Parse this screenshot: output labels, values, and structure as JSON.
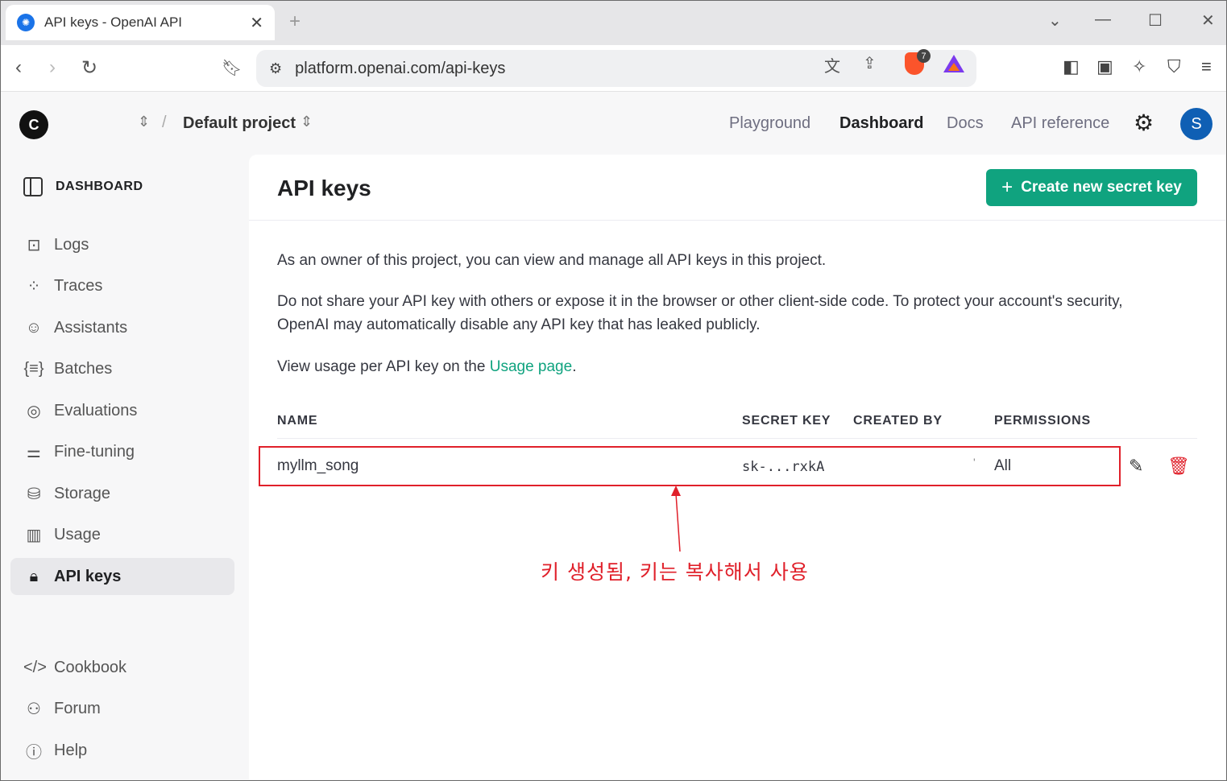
{
  "browser": {
    "tab_title": "API keys - OpenAI API",
    "url": "platform.openai.com/api-keys",
    "extension_badge": "7"
  },
  "header": {
    "org_initial": "C",
    "project_name": "Default project",
    "links": [
      "Playground",
      "Dashboard",
      "Docs",
      "API reference"
    ],
    "active_link": "Dashboard",
    "user_initial": "S"
  },
  "sidebar": {
    "heading": "DASHBOARD",
    "items": [
      {
        "label": "Logs",
        "icon": "terminal-icon"
      },
      {
        "label": "Traces",
        "icon": "traces-icon"
      },
      {
        "label": "Assistants",
        "icon": "assistant-icon"
      },
      {
        "label": "Batches",
        "icon": "batches-icon"
      },
      {
        "label": "Evaluations",
        "icon": "evaluations-icon"
      },
      {
        "label": "Fine-tuning",
        "icon": "sliders-icon"
      },
      {
        "label": "Storage",
        "icon": "database-icon"
      },
      {
        "label": "Usage",
        "icon": "bar-chart-icon"
      },
      {
        "label": "API keys",
        "icon": "lock-icon"
      }
    ],
    "active": "API keys",
    "footer_items": [
      {
        "label": "Cookbook",
        "icon": "code-icon"
      },
      {
        "label": "Forum",
        "icon": "users-icon"
      },
      {
        "label": "Help",
        "icon": "help-icon"
      }
    ]
  },
  "main": {
    "title": "API keys",
    "create_button": "Create new secret key",
    "paragraph1": "As an owner of this project, you can view and manage all API keys in this project.",
    "paragraph2": "Do not share your API key with others or expose it in the browser or other client-side code. To protect your account's security, OpenAI may automatically disable any API key that has leaked publicly.",
    "paragraph3_prefix": "View usage per API key on the ",
    "paragraph3_link": "Usage page",
    "paragraph3_suffix": ".",
    "table": {
      "columns": [
        "NAME",
        "SECRET KEY",
        "CREATED BY",
        "PERMISSIONS"
      ],
      "rows": [
        {
          "name": "myllm_song",
          "secret_key": "sk-...rxkA",
          "created_by": "'",
          "permissions": "All"
        }
      ]
    }
  },
  "annotation": {
    "text": "키 생성됨, 키는 복사해서 사용",
    "color": "#e0202a"
  },
  "colors": {
    "accent": "#10a37f",
    "annotation_red": "#e0202a"
  }
}
